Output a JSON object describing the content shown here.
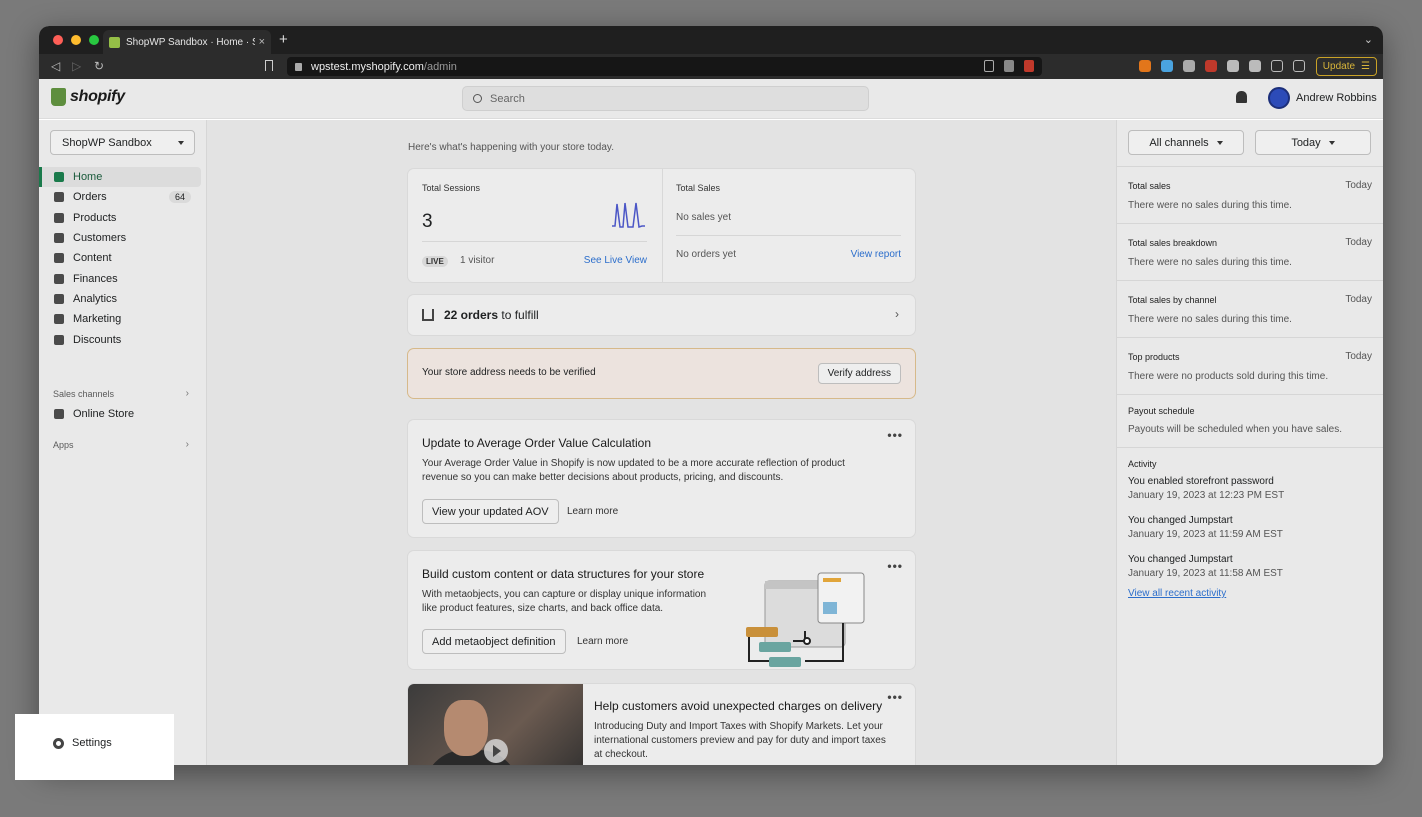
{
  "browser": {
    "tab_title": "ShopWP Sandbox · Home · Shop",
    "new_tab": "+",
    "tab_close": "×",
    "url_host": "wpstest.myshopify.com",
    "url_path": "/admin",
    "update_label": "Update",
    "colors": {
      "red": "#ff5f57",
      "yellow": "#febc2e",
      "green": "#28c840"
    }
  },
  "header": {
    "logo_text": "shopify",
    "search_placeholder": "Search",
    "user_name": "Andrew Robbins"
  },
  "sidebar": {
    "store_name": "ShopWP Sandbox",
    "items": [
      {
        "label": "Home",
        "icon": "home-icon"
      },
      {
        "label": "Orders",
        "icon": "orders-icon",
        "badge": "64"
      },
      {
        "label": "Products",
        "icon": "tag-icon"
      },
      {
        "label": "Customers",
        "icon": "person-icon"
      },
      {
        "label": "Content",
        "icon": "content-icon"
      },
      {
        "label": "Finances",
        "icon": "bank-icon"
      },
      {
        "label": "Analytics",
        "icon": "bar-chart-icon"
      },
      {
        "label": "Marketing",
        "icon": "target-icon"
      },
      {
        "label": "Discounts",
        "icon": "discount-icon"
      }
    ],
    "sales_channels_label": "Sales channels",
    "online_store_label": "Online Store",
    "apps_label": "Apps",
    "settings_label": "Settings"
  },
  "main": {
    "greeting": "Here's what's happening with your store today.",
    "sessions": {
      "label": "Total Sessions",
      "value": "3",
      "live": "LIVE",
      "visitors": "1 visitor",
      "link": "See Live View"
    },
    "sales": {
      "label": "Total Sales",
      "no_sales": "No sales yet",
      "no_orders": "No orders yet",
      "link": "View report"
    },
    "orders": {
      "bold": "22 orders",
      "rest": "to fulfill"
    },
    "verify": {
      "text": "Your store address needs to be verified",
      "button": "Verify address"
    },
    "aov": {
      "title": "Update to Average Order Value Calculation",
      "body1": "Your Average Order Value in Shopify is now updated to be a more accurate reflection of product",
      "body2": "revenue so you can make better decisions about products, pricing, and discounts.",
      "button": "View your updated AOV",
      "link": "Learn more"
    },
    "meta": {
      "title": "Build custom content or data structures for your store",
      "body1": "With metaobjects, you can capture or display unique information",
      "body2": "like product features, size charts, and back office data.",
      "button": "Add metaobject definition",
      "link": "Learn more"
    },
    "duty": {
      "title": "Help customers avoid unexpected charges on delivery",
      "body1": "Introducing Duty and Import Taxes with Shopify Markets. Let your",
      "body2": "international customers preview and pay for duty and import taxes",
      "body3": "at checkout."
    },
    "more": "•••"
  },
  "right": {
    "channels": "All channels",
    "period": "Today",
    "sections": [
      {
        "title": "Total sales",
        "date": "Today",
        "text": "There were no sales during this time."
      },
      {
        "title": "Total sales breakdown",
        "date": "Today",
        "text": "There were no sales during this time."
      },
      {
        "title": "Total sales by channel",
        "date": "Today",
        "text": "There were no sales during this time."
      },
      {
        "title": "Top products",
        "date": "Today",
        "text": "There were no products sold during this time."
      }
    ],
    "payout": {
      "title": "Payout schedule",
      "text": "Payouts will be scheduled when you have sales."
    },
    "activity": {
      "title": "Activity",
      "items": [
        {
          "text": "You enabled storefront password",
          "time": "January 19, 2023 at 12:23 PM EST"
        },
        {
          "text": "You changed Jumpstart",
          "time": "January 19, 2023 at 11:59 AM EST"
        },
        {
          "text": "You changed Jumpstart",
          "time": "January 19, 2023 at 11:58 AM EST"
        }
      ],
      "link": "View all recent activity"
    }
  }
}
